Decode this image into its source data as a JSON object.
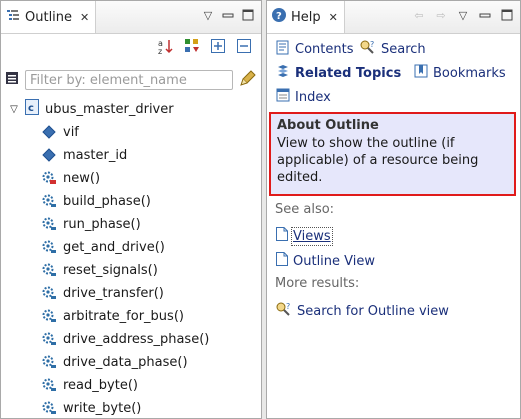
{
  "outline": {
    "tab_title": "Outline",
    "filter_placeholder": "Filter by: element_name",
    "root_label": "ubus_master_driver",
    "items": [
      {
        "label": "vif",
        "kind": "field"
      },
      {
        "label": "master_id",
        "kind": "field"
      },
      {
        "label": "new()",
        "kind": "method-red"
      },
      {
        "label": "build_phase()",
        "kind": "method"
      },
      {
        "label": "run_phase()",
        "kind": "method"
      },
      {
        "label": "get_and_drive()",
        "kind": "method"
      },
      {
        "label": "reset_signals()",
        "kind": "method"
      },
      {
        "label": "drive_transfer()",
        "kind": "method"
      },
      {
        "label": "arbitrate_for_bus()",
        "kind": "method"
      },
      {
        "label": "drive_address_phase()",
        "kind": "method"
      },
      {
        "label": "drive_data_phase()",
        "kind": "method"
      },
      {
        "label": "read_byte()",
        "kind": "method"
      },
      {
        "label": "write_byte()",
        "kind": "method"
      }
    ]
  },
  "help": {
    "tab_title": "Help",
    "contents_label": "Contents",
    "search_label": "Search",
    "related_topics_label": "Related Topics",
    "bookmarks_label": "Bookmarks",
    "index_label": "Index",
    "about_title": "About Outline",
    "about_text": "View to show the outline (if applicable) of a resource being edited.",
    "see_also_label": "See also:",
    "see_also_links": [
      "Views",
      "Outline View"
    ],
    "more_results_label": "More results:",
    "search_result": "Search for Outline view"
  },
  "colors": {
    "link": "#1a2f7a",
    "highlight_bg": "#e6e7fb",
    "highlight_border": "#e01a1a",
    "method_icon": "#2e6ea6",
    "field_icon": "#3a6fb0"
  }
}
